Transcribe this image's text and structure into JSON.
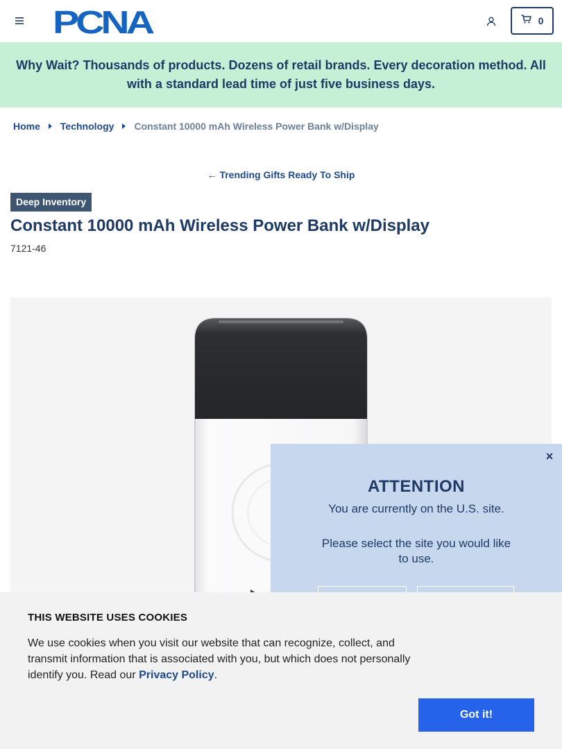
{
  "header": {
    "logo_text": "PCNA",
    "cart_count": "0"
  },
  "promo": {
    "text": "Why Wait? Thousands of products. Dozens of retail brands. Every decoration method. All with a standard lead time of just five business days."
  },
  "breadcrumb": {
    "items": [
      {
        "label": "Home"
      },
      {
        "label": "Technology"
      }
    ],
    "current": "Constant 10000 mAh Wireless Power Bank w/Display"
  },
  "back_link": "Trending Gifts Ready To Ship",
  "product": {
    "badge": "Deep Inventory",
    "title": "Constant 10000 mAh Wireless Power Bank w/Display",
    "sku": "7121-46"
  },
  "region_modal": {
    "close": "×",
    "title": "ATTENTION",
    "line1": "You are currently on the U.S. site.",
    "line2": "Please select the site you would like to use."
  },
  "cookie_banner": {
    "title": "THIS WEBSITE USES COOKIES",
    "body": "We use cookies when you visit our website that can recognize, collect, and transmit information that is associated with you, but which does not personally identify you. Read our ",
    "link": "Privacy Policy",
    "period": ".",
    "button": "Got it!"
  },
  "colors": {
    "brand_navy": "#1e3a64",
    "promo_bg": "#c5f0d5",
    "badge_bg": "#3f5673",
    "modal_bg": "#c7d7ee",
    "cta_blue": "#2563eb"
  }
}
